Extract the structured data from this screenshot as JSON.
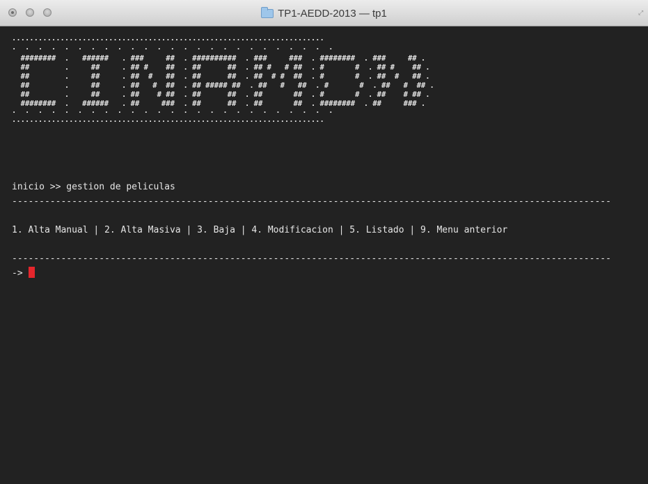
{
  "window": {
    "title": "TP1-AEDD-2013 — tp1"
  },
  "terminal": {
    "banner": "·······································································\n·  ·  ·  ·  ·  ·  ·  ·  ·  ·  ·  ·  ·  ·  ·  ·  ·  ·  ·  ·  ·  ·  ·  ·  ·\n  ########  .   ######   . ###     ##  . ##########  . ###     ###  . ########  . ###     ## .\n  ##        .     ##     . ## #    ##  . ##      ##  . ## #   # ##  . #       #  . ## #    ## .\n  ##        .     ##     . ##  #   ##  . ##      ##  . ##  # #  ##  . #       #  . ##  #   ## .\n  ##        .     ##     . ##   #  ##  . ## ##### ##  . ##   #   ##  . #       #  . ##   #  ## .\n  ##        .     ##     . ##    # ##  . ##      ##  . ##       ##  . #       #  . ##    # ## .\n  ########  .   ######   . ##     ###  . ##      ##  . ##       ##  . ########  . ##     ### .\n·  ·  ·  ·  ·  ·  ·  ·  ·  ·  ·  ·  ·  ·  ·  ·  ·  ·  ·  ·  ·  ·  ·  ·  ·\n·······································································",
    "breadcrumb": "inicio >> gestion de peliculas",
    "separator": "--------------------------------------------------------------------------------------------------------------",
    "menu": "1. Alta Manual | 2. Alta Masiva | 3. Baja | 4. Modificacion | 5. Listado | 9. Menu anterior",
    "prompt": "->"
  },
  "colors": {
    "background": "#222222",
    "text": "#e6e6e6",
    "cursor": "#e5262c"
  },
  "icons": {
    "title_icon": "folder-icon",
    "resize": "resize-icon"
  }
}
